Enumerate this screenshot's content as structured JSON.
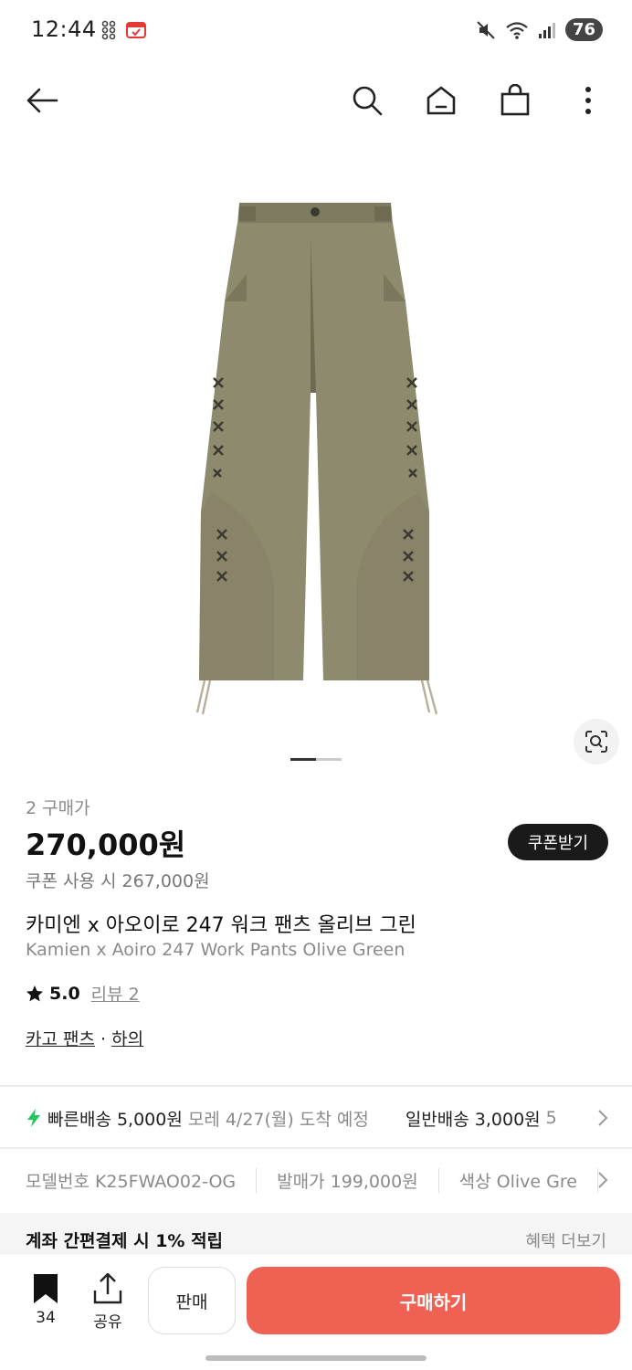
{
  "status_bar": {
    "time": "12:44",
    "battery": "76"
  },
  "product": {
    "purchase_count": "2 구매가",
    "price": "270,000원",
    "coupon_button": "쿠폰받기",
    "coupon_price": "쿠폰 사용 시 267,000원",
    "title_ko": "카미엔 x 아오이로 247 워크 팬츠 올리브 그린",
    "title_en": "Kamien x Aoiro 247 Work Pants Olive Green",
    "rating": "5.0",
    "review_label": "리뷰 2",
    "category_1": "카고 팬츠",
    "category_sep": " · ",
    "category_2": "하의",
    "image_colors": {
      "fabric": "#8e8a6e",
      "shade": "#7b775c",
      "stitch": "#3b3a30"
    }
  },
  "shipping": {
    "fast_label": "빠른배송 5,000원",
    "fast_eta": "모레 4/27(월) 도착 예정",
    "normal_label": "일반배송 3,000원",
    "normal_eta": "5"
  },
  "specs": [
    {
      "label": "모델번호 K25FWAO02-OG"
    },
    {
      "label": "발매가 199,000원"
    },
    {
      "label": "색상 Olive Gre"
    }
  ],
  "benefit": {
    "title": "계좌 간편결제 시 1% 적립",
    "more": "혜택 더보기"
  },
  "bottom_bar": {
    "bookmark_count": "34",
    "share_label": "공유",
    "sell_label": "판매",
    "buy_label": "구매하기"
  },
  "colors": {
    "accent": "#ef6253",
    "bolt": "#22c55e"
  }
}
